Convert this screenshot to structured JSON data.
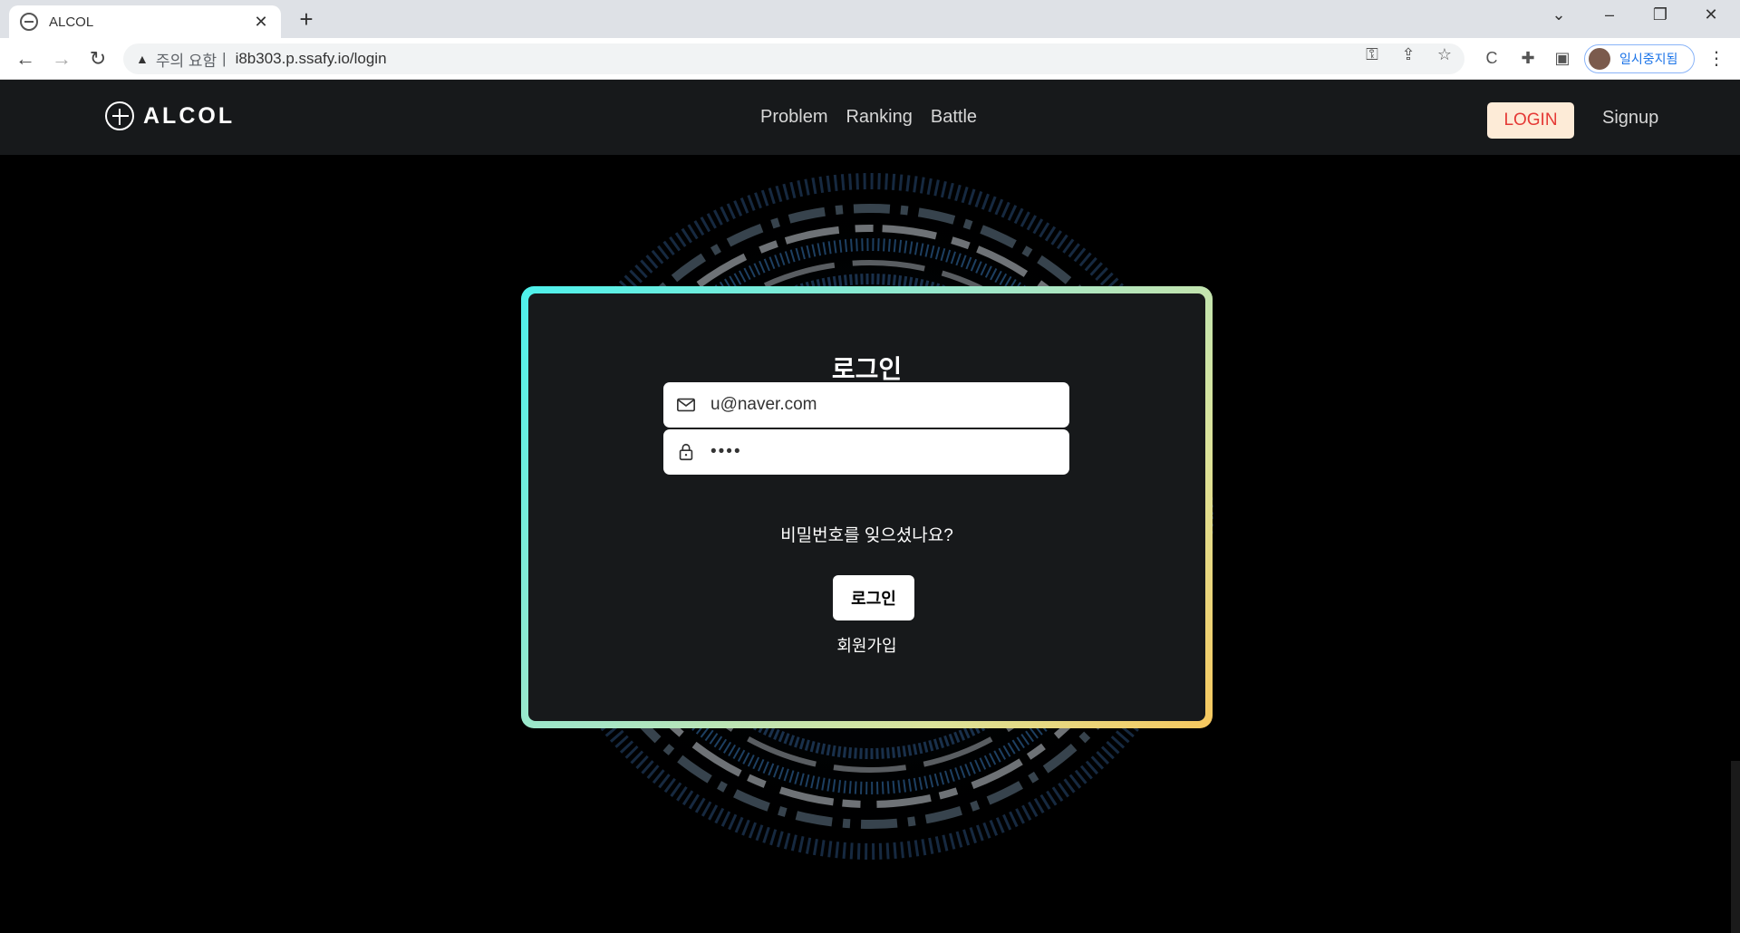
{
  "browser": {
    "tab_title": "ALCOL",
    "tab_close": "✕",
    "new_tab": "+",
    "security_warning": "주의 요함",
    "separator": "|",
    "url": "i8b303.p.ssafy.io/login",
    "profile_label": "일시중지됨"
  },
  "header": {
    "logo_text": "ALCOL",
    "nav": [
      "Problem",
      "Ranking",
      "Battle"
    ],
    "login_label": "LOGIN",
    "signup_label": "Signup"
  },
  "login": {
    "title": "로그인",
    "email_value": "u@naver.com",
    "password_value": "••••",
    "forgot_label": "비밀번호를 잊으셨나요?",
    "submit_label": "로그인",
    "join_label": "회원가입"
  },
  "colors": {
    "login_button_bg": "#fdebd7",
    "login_button_text": "#e53935",
    "card_gradient_start": "#4df1ec",
    "card_gradient_end": "#f7c85e"
  }
}
